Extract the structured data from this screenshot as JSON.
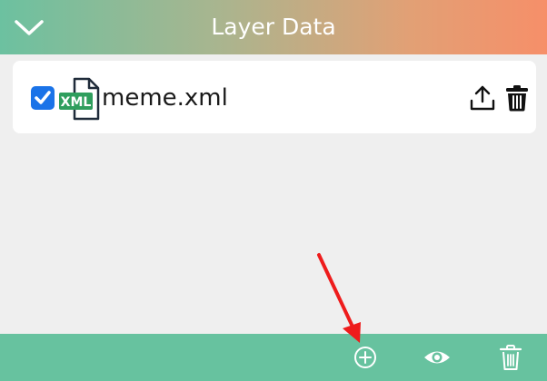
{
  "header": {
    "title": "Layer Data",
    "collapse_icon": "chevron-down-icon",
    "gradient_colors": [
      "#6cc1a0",
      "#f68f69"
    ]
  },
  "layers": [
    {
      "checked": true,
      "file_icon": "xml-file-icon",
      "file_badge": "XML",
      "file_name": "meme.xml",
      "actions": [
        "upload-icon",
        "trash-icon"
      ]
    }
  ],
  "footer": {
    "color": "#67c29f",
    "actions": [
      "add-circle-icon",
      "eye-icon",
      "trash-icon"
    ]
  },
  "annotation": {
    "arrow_color": "#ee1c1c",
    "points_to": "add-layer-button"
  }
}
